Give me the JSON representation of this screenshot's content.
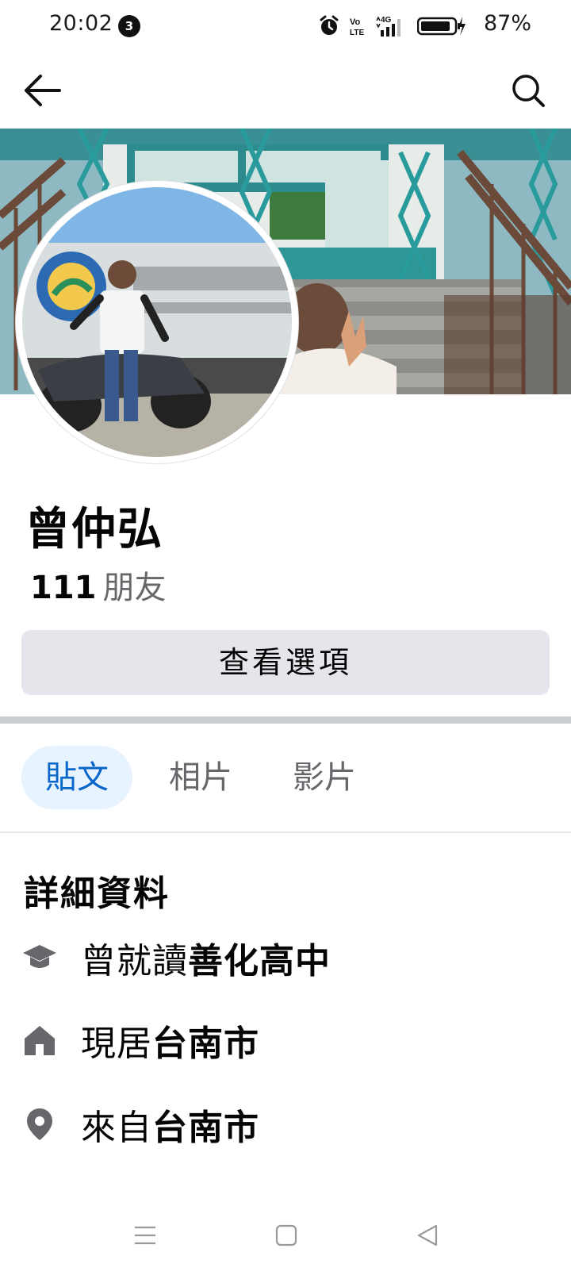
{
  "status_bar": {
    "time": "20:02",
    "notification_count": "3",
    "battery_percent": "87%",
    "network": "4G"
  },
  "profile": {
    "name": "曾仲弘",
    "friends_count": "111",
    "friends_label": "朋友",
    "options_button": "查看選項"
  },
  "tabs": [
    {
      "label": "貼文",
      "active": true
    },
    {
      "label": "相片",
      "active": false
    },
    {
      "label": "影片",
      "active": false
    }
  ],
  "details": {
    "title": "詳細資料",
    "items": [
      {
        "icon": "graduation-cap-icon",
        "prefix": "曾就讀",
        "value": "善化高中"
      },
      {
        "icon": "home-icon",
        "prefix": "現居",
        "value": "台南市"
      },
      {
        "icon": "location-pin-icon",
        "prefix": "來自",
        "value": "台南市"
      }
    ]
  },
  "colors": {
    "accent": "#0a66c8",
    "tab_active_bg": "#e7f3ff",
    "button_bg": "#e4e6eb",
    "secondary_text": "#65676b"
  }
}
